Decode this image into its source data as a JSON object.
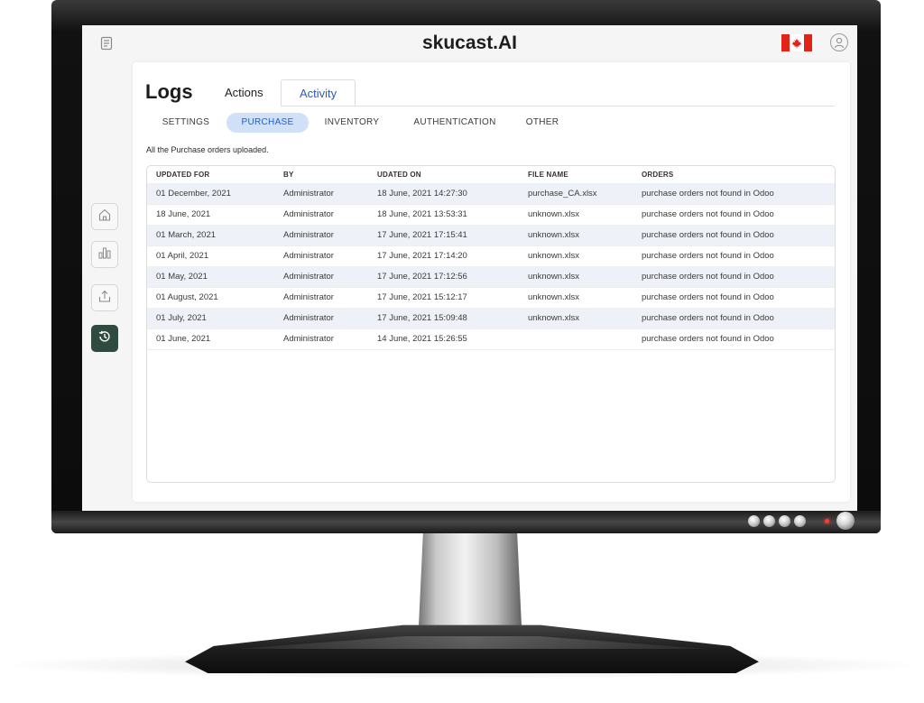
{
  "app": {
    "title": "skucast.AI"
  },
  "icons": {
    "top_left": "receipt-icon",
    "country": "canada-flag",
    "user": "user-icon",
    "sidebar": [
      "home-icon",
      "bar-chart-icon",
      "upload-icon",
      "history-icon"
    ]
  },
  "colors": {
    "accent": "#2a5bbf",
    "sidebar_active": "#2f4a3f",
    "subtab_active_bg": "#cfe0f7",
    "row_alt": "#eef2f8",
    "status_led": "#ff3b2f"
  },
  "page": {
    "title": "Logs",
    "tabs": [
      {
        "label": "Actions",
        "active": false
      },
      {
        "label": "Activity",
        "active": true
      }
    ],
    "subtabs": [
      {
        "label": "SETTINGS",
        "active": false
      },
      {
        "label": "PURCHASE",
        "active": true
      },
      {
        "label": "INVENTORY",
        "active": false
      },
      {
        "label": "AUTHENTICATION",
        "active": false
      },
      {
        "label": "OTHER",
        "active": false
      }
    ],
    "description": "All the Purchase orders uploaded."
  },
  "table": {
    "columns": [
      "UPDATED FOR",
      "BY",
      "UDATED ON",
      "FILE NAME",
      "ORDERS"
    ],
    "rows": [
      [
        "01 December, 2021",
        "Administrator",
        "18 June, 2021 14:27:30",
        "purchase_CA.xlsx",
        "purchase orders not found in Odoo"
      ],
      [
        "18 June, 2021",
        "Administrator",
        "18 June, 2021 13:53:31",
        "unknown.xlsx",
        "purchase orders not found in Odoo"
      ],
      [
        "01 March, 2021",
        "Administrator",
        "17 June, 2021 17:15:41",
        "unknown.xlsx",
        "purchase orders not found in Odoo"
      ],
      [
        "01 April, 2021",
        "Administrator",
        "17 June, 2021 17:14:20",
        "unknown.xlsx",
        "purchase orders not found in Odoo"
      ],
      [
        "01 May, 2021",
        "Administrator",
        "17 June, 2021 17:12:56",
        "unknown.xlsx",
        "purchase orders not found in Odoo"
      ],
      [
        "01 August, 2021",
        "Administrator",
        "17 June, 2021 15:12:17",
        "unknown.xlsx",
        "purchase orders not found in Odoo"
      ],
      [
        "01 July, 2021",
        "Administrator",
        "17 June, 2021 15:09:48",
        "unknown.xlsx",
        "purchase orders not found in Odoo"
      ],
      [
        "01 June, 2021",
        "Administrator",
        "14 June, 2021 15:26:55",
        "",
        "purchase orders not found in Odoo"
      ]
    ]
  }
}
